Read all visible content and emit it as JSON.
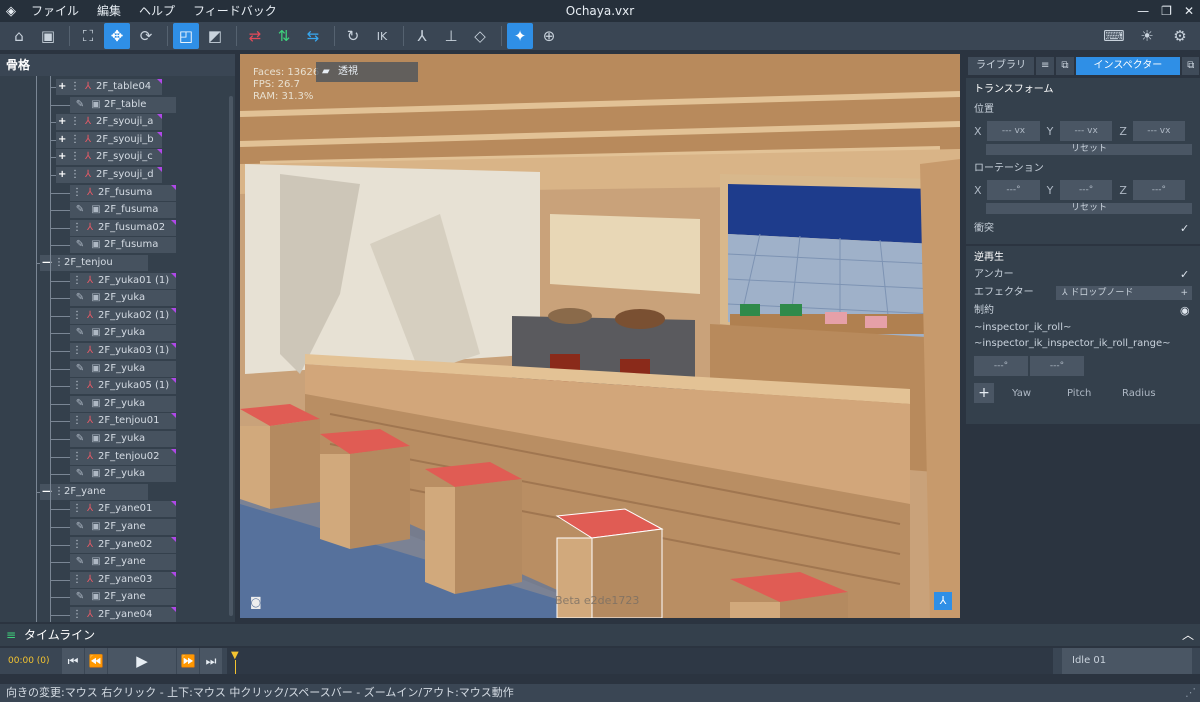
{
  "window": {
    "title": "Ochaya.vxr",
    "menus": [
      "ファイル",
      "編集",
      "ヘルプ",
      "フィードバック"
    ],
    "controls": {
      "minimize": "—",
      "restore": "❐",
      "close": "✕"
    }
  },
  "toolbar": {
    "tools": [
      {
        "name": "home-icon",
        "glyph": "⌂"
      },
      {
        "name": "save-icon",
        "glyph": "▣"
      },
      {
        "name": "fit-view-icon",
        "glyph": "⛶"
      },
      {
        "name": "move-icon",
        "glyph": "✥",
        "active": true
      },
      {
        "name": "rotate-icon",
        "glyph": "⟳"
      },
      {
        "name": "local-space-icon",
        "glyph": "◰",
        "active": true
      },
      {
        "name": "pivot-icon",
        "glyph": "◩"
      },
      {
        "name": "flip-x-icon",
        "glyph": "⇄",
        "color": "red"
      },
      {
        "name": "flip-y-icon",
        "glyph": "⇅",
        "color": "green"
      },
      {
        "name": "flip-z-icon",
        "glyph": "⇆",
        "color": "blue"
      },
      {
        "name": "sync-icon",
        "glyph": "↻"
      },
      {
        "name": "ik-icon",
        "glyph": "IK"
      },
      {
        "name": "bone-axis-icon",
        "glyph": "⅄"
      },
      {
        "name": "hierarchy-icon",
        "glyph": "⊥"
      },
      {
        "name": "cube-icon",
        "glyph": "◇"
      },
      {
        "name": "sparkle-icon",
        "glyph": "✦",
        "active": true
      },
      {
        "name": "target-icon",
        "glyph": "⊕"
      }
    ],
    "right": [
      {
        "name": "keyboard-icon",
        "glyph": "⌨"
      },
      {
        "name": "lightbulb-icon",
        "glyph": "☀"
      },
      {
        "name": "settings-icon",
        "glyph": "⚙"
      }
    ]
  },
  "left_panel": {
    "title": "骨格",
    "nodes": [
      {
        "label": "2F_table04",
        "type": "bone",
        "pm": "+"
      },
      {
        "label": "2F_table",
        "type": "mesh"
      },
      {
        "label": "2F_syouji_a",
        "type": "bone",
        "pm": "+"
      },
      {
        "label": "2F_syouji_b",
        "type": "bone",
        "pm": "+"
      },
      {
        "label": "2F_syouji_c",
        "type": "bone",
        "pm": "+"
      },
      {
        "label": "2F_syouji_d",
        "type": "bone",
        "pm": "+"
      },
      {
        "label": "2F_fusuma",
        "type": "bone"
      },
      {
        "label": "2F_fusuma",
        "type": "mesh"
      },
      {
        "label": "2F_fusuma02",
        "type": "bone"
      },
      {
        "label": "2F_fusuma",
        "type": "mesh"
      },
      {
        "label": "2F_tenjou",
        "type": "bone",
        "pm": "—"
      },
      {
        "label": "2F_yuka01 (1)",
        "type": "bone"
      },
      {
        "label": "2F_yuka",
        "type": "mesh"
      },
      {
        "label": "2F_yuka02 (1)",
        "type": "bone"
      },
      {
        "label": "2F_yuka",
        "type": "mesh"
      },
      {
        "label": "2F_yuka03 (1)",
        "type": "bone"
      },
      {
        "label": "2F_yuka",
        "type": "mesh"
      },
      {
        "label": "2F_yuka05 (1)",
        "type": "bone"
      },
      {
        "label": "2F_yuka",
        "type": "mesh"
      },
      {
        "label": "2F_tenjou01",
        "type": "bone"
      },
      {
        "label": "2F_yuka",
        "type": "mesh"
      },
      {
        "label": "2F_tenjou02",
        "type": "bone"
      },
      {
        "label": "2F_yuka",
        "type": "mesh"
      },
      {
        "label": "2F_yane",
        "type": "bone",
        "pm": "—"
      },
      {
        "label": "2F_yane01",
        "type": "bone"
      },
      {
        "label": "2F_yane",
        "type": "mesh"
      },
      {
        "label": "2F_yane02",
        "type": "bone"
      },
      {
        "label": "2F_yane",
        "type": "mesh"
      },
      {
        "label": "2F_yane03",
        "type": "bone"
      },
      {
        "label": "2F_yane",
        "type": "mesh"
      },
      {
        "label": "2F_yane04",
        "type": "bone"
      }
    ]
  },
  "viewport": {
    "faces": "Faces: 13626",
    "fps": "FPS: 26.7",
    "ram": "RAM: 31.3%",
    "view_mode": "透視",
    "watermark": "Beta e2de1723"
  },
  "right_panel": {
    "tabs": {
      "library": "ライブラリ",
      "list_icon": "≡",
      "popout_icon": "⧉",
      "inspector": "インスペクター",
      "popout2_icon": "⧉"
    },
    "transform": {
      "title": "トランスフォーム",
      "position_label": "位置",
      "position": {
        "x": "--- vx",
        "y": "--- vx",
        "z": "--- vx"
      },
      "reset": "リセット",
      "rotation_label": "ローテーション",
      "rotation": {
        "x": "---°",
        "y": "---°",
        "z": "---°"
      },
      "reset2": "リセット",
      "collision_label": "衝突",
      "collision_checked": "✓"
    },
    "ik": {
      "title": "逆再生",
      "anchor_label": "アンカー",
      "anchor_checked": "✓",
      "effector_label": "エフェクター",
      "effector_value": "ドロップノード",
      "effector_plus": "+",
      "constraint_label": "制約",
      "roll": "~inspector_ik_roll~",
      "roll_range": "~inspector_ik_inspector_ik_roll_range~",
      "roll_values": [
        "---°",
        "---°"
      ],
      "add": "+",
      "headers": [
        "Yaw",
        "Pitch",
        "Radius"
      ]
    }
  },
  "timeline": {
    "title": "タイムライン",
    "timecode": "00:00 (0)",
    "animation": "Idle 01"
  },
  "statusbar": {
    "text": "向きの変更:マウス 右クリック - 上下:マウス 中クリック/スペースバー - ズームイン/アウト:マウス動作"
  }
}
